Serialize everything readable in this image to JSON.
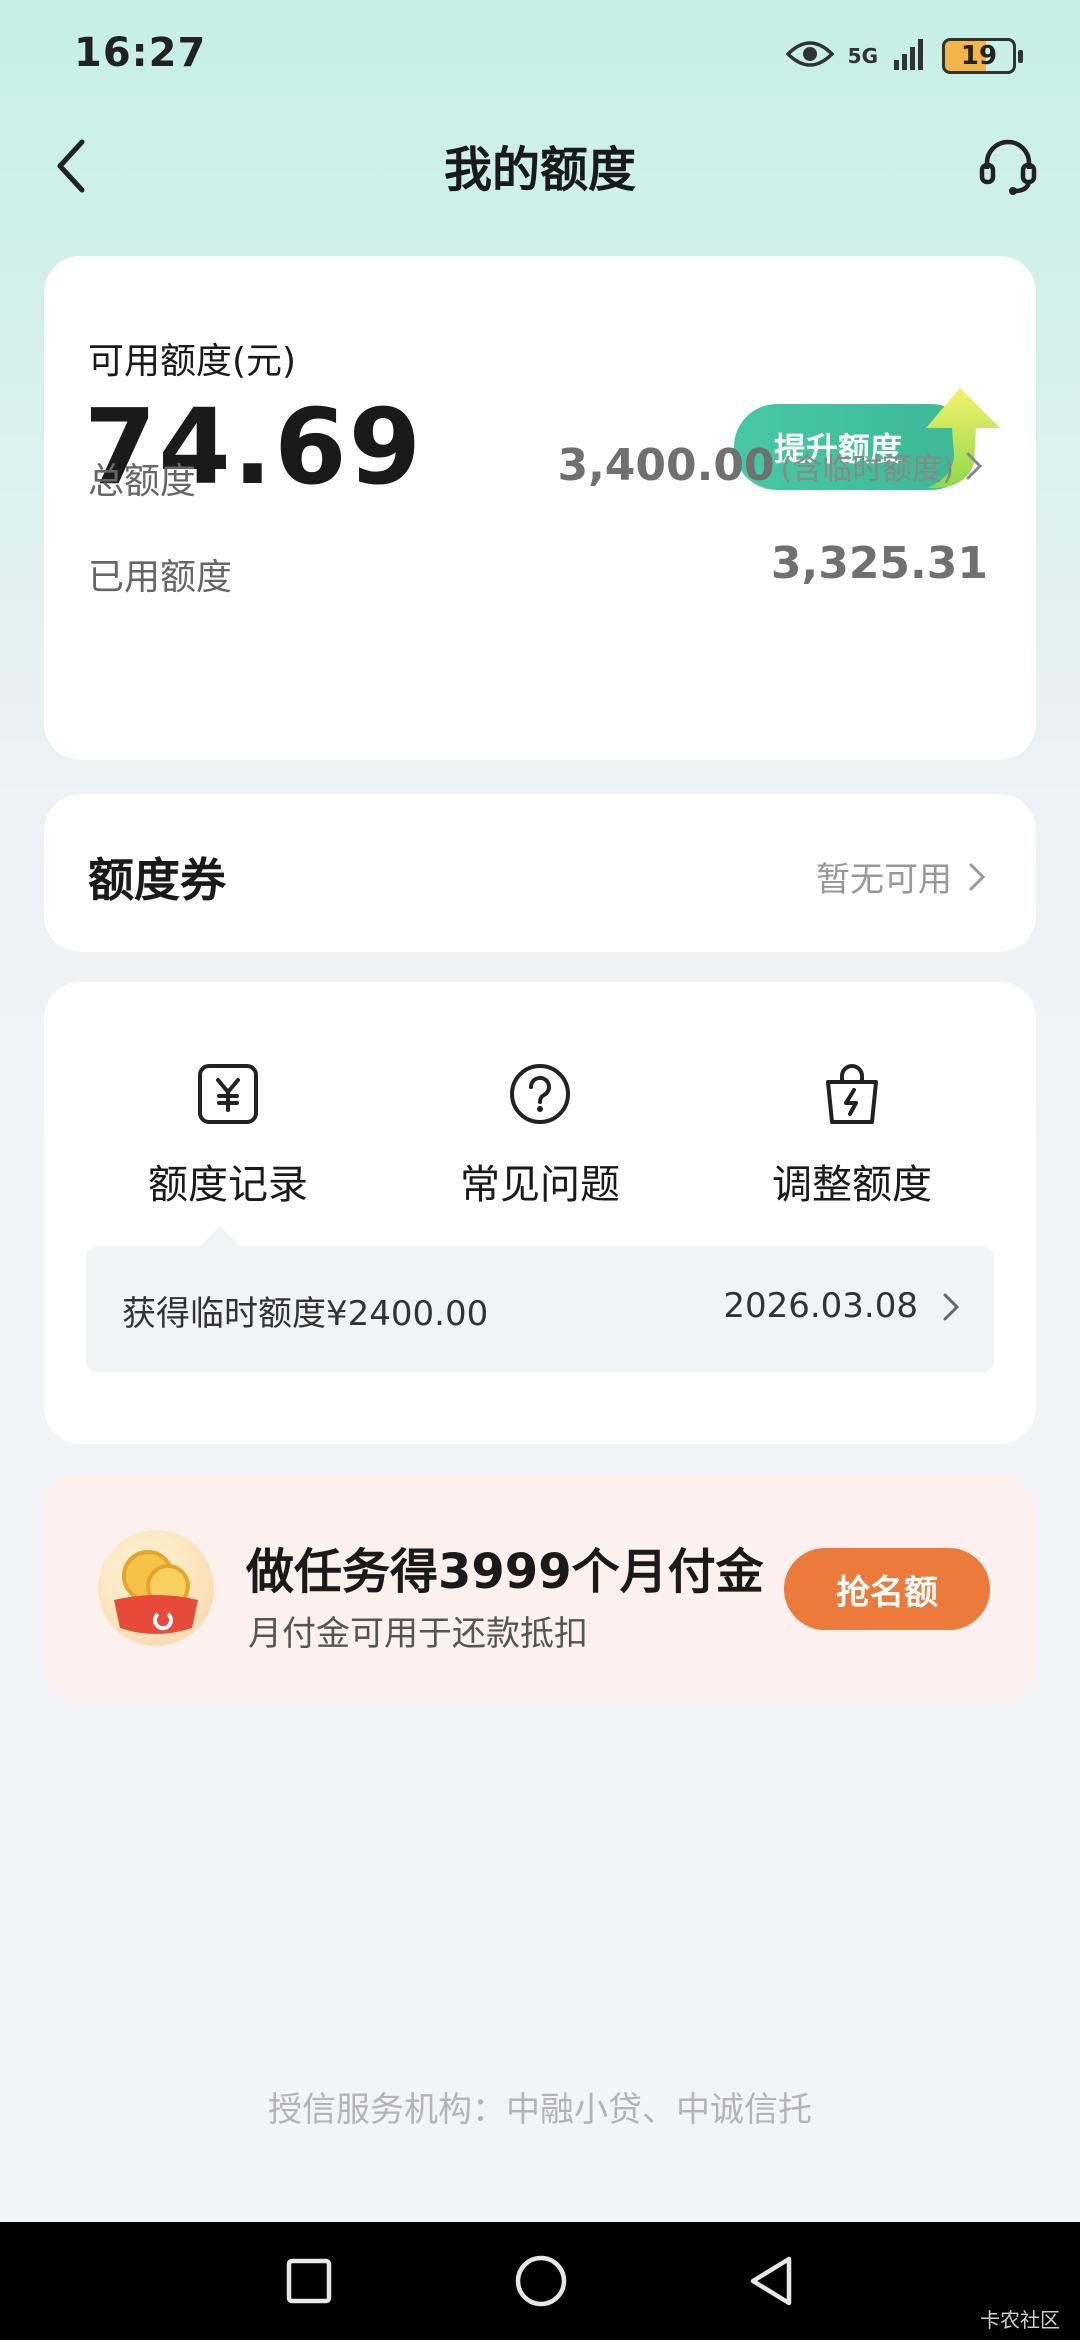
{
  "status_bar": {
    "time": "16:27",
    "network": "5G",
    "battery": "19"
  },
  "header": {
    "title": "我的额度"
  },
  "quota": {
    "available_label": "可用额度(元)",
    "available_amount": "74.69",
    "raise_button": "提升额度",
    "total_label": "总额度",
    "total_value": "3,400.00",
    "total_note": "(含临时额度)",
    "used_label": "已用额度",
    "used_value": "3,325.31"
  },
  "coupon": {
    "title": "额度券",
    "status": "暂无可用"
  },
  "actions": [
    {
      "label": "额度记录",
      "icon": "yuan-icon"
    },
    {
      "label": "常见问题",
      "icon": "question-icon"
    },
    {
      "label": "调整额度",
      "icon": "bag-bolt-icon"
    }
  ],
  "notice": {
    "text": "获得临时额度¥2400.00",
    "date": "2026.03.08"
  },
  "promo": {
    "title": "做任务得3999个月付金",
    "subtitle": "月付金可用于还款抵扣",
    "button": "抢名额"
  },
  "footer": {
    "note": "授信服务机构：中融小贷、中诚信托"
  },
  "watermark": "卡农社区",
  "colors": {
    "accent_green": "#47c8a5",
    "promo_orange": "#ec7a3a",
    "header_bg": "#c5efe6"
  }
}
